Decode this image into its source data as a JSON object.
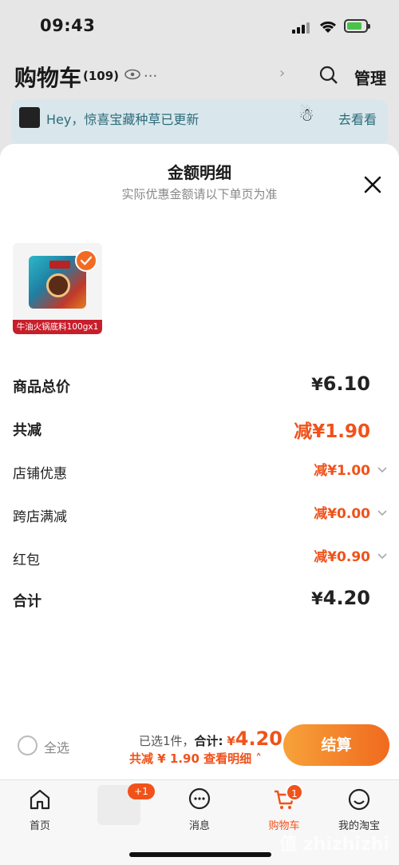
{
  "status_bar": {
    "time": "09:43"
  },
  "background": {
    "title": "购物车",
    "count": "(109)",
    "dots": "...",
    "manage": "管理",
    "banner_text": "Hey，惊喜宝藏种草已更新",
    "banner_link": "去看看"
  },
  "sheet": {
    "title": "金额明细",
    "subtitle": "实际优惠金额请以下单页为准",
    "product_label": "牛油火锅底料100gx1",
    "rows": [
      {
        "label": "商品总价",
        "amount": "6.10"
      },
      {
        "label": "共减",
        "amount": "1.90",
        "prefix": "减"
      },
      {
        "label": "店铺优惠",
        "amount": "1.00",
        "prefix": "减"
      },
      {
        "label": "跨店满减",
        "amount": "0.00",
        "prefix": "减"
      },
      {
        "label": "红包",
        "amount": "0.90",
        "prefix": "减"
      },
      {
        "label": "合计",
        "amount": "4.20"
      }
    ],
    "currency": "¥"
  },
  "checkout": {
    "select_all": "全选",
    "selected_text": "已选1件，",
    "total_label": "合计:",
    "total_currency": "¥",
    "total_value": "4.20",
    "discount_text": "共减 ¥ 1.90",
    "detail_link": "查看明细",
    "pay_button": "结算"
  },
  "tabbar": {
    "tabs": [
      {
        "label": "首页",
        "icon": "home-icon"
      },
      {
        "label": "",
        "icon": "product-thumb",
        "badge": "+1"
      },
      {
        "label": "消息",
        "icon": "message-icon"
      },
      {
        "label": "购物车",
        "icon": "cart-icon",
        "badge": "1"
      },
      {
        "label": "我的淘宝",
        "icon": "profile-icon"
      }
    ]
  },
  "watermark": "值 什么值得买",
  "colors": {
    "accent": "#f0521a",
    "pay_gradient_start": "#f7a23a",
    "pay_gradient_end": "#f06a1e"
  }
}
